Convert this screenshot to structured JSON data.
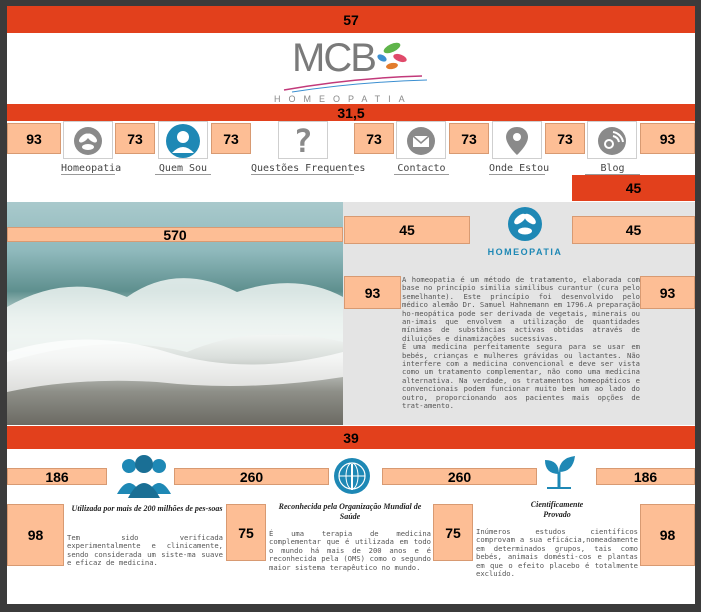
{
  "header": {
    "top_bar_label": "57",
    "brand_logo": "MCB",
    "brand_subtitle": "HOMEOPATIA",
    "sub_bar_label": "31,5"
  },
  "nav": {
    "spacers": {
      "outer": "93",
      "inner": "73"
    },
    "items": [
      {
        "label": "Homeopatia",
        "icon": "leaves-icon"
      },
      {
        "label": "Quem Sou",
        "icon": "user-icon"
      },
      {
        "label": "Questões Frequentes",
        "icon": "question-icon"
      },
      {
        "label": "Contacto",
        "icon": "mail-icon"
      },
      {
        "label": "Onde Estou",
        "icon": "location-pin-icon"
      },
      {
        "label": "Blog",
        "icon": "blog-icon"
      }
    ]
  },
  "intro": {
    "right_bar_label": "45",
    "image_width_label": "570",
    "spacer_45_left": "45",
    "spacer_45_right": "45",
    "spacer_93_left": "93",
    "spacer_93_right": "93",
    "logo_text": "HOMEOPATIA",
    "paragraph_1": "A homeopatia é um método de tratamento, elaborada com base no princípio similia similibus curantur (cura pelo semelhante). Este princípio foi desenvolvido pelo médico alemão Dr. Samuel Hahnemann em 1796.A preparação ho-meopática pode ser derivada de vegetais, minerais ou an-imais que envolvem a utilização de quantidades mínimas de substâncias activas obtidas através de diluições e dinamizações sucessivas.",
    "paragraph_2": "É uma medicina perfeitamente segura para se usar em bebés, crianças e mulheres grávidas ou lactantes. Não interfere com a medicina convencional e deve ser vista como um tratamento complementar, não como uma medicina alternativa. Na verdade, os tratamentos homeopáticos e convencionais podem funcionar muito bem um ao lado do outro, proporcionando aos pacientes mais opções de trat-amento."
  },
  "features": {
    "bar_label": "39",
    "spacers": {
      "s186": "186",
      "s260": "260",
      "s98": "98",
      "s75": "75"
    },
    "items": [
      {
        "title": "Utilizada por mais de 200 milhões de pes-soas",
        "text": "Tem sido verificada experimentalmente e clinicamente, sendo considerada um siste-ma suave e eficaz de medicina.",
        "icon": "people-icon"
      },
      {
        "title": "Reconhecida pela Organização Mundial de Saúde",
        "text": "É uma terapia de medicina complementar que é utilizada em todo o mundo há mais de 200 anos e é reconhecida pela (OMS) como o segundo maior sistema terapêutico no mundo.",
        "icon": "who-icon"
      },
      {
        "title": "Cientificamente Provado",
        "text": "Inúmeros estudos científicos comprovam a sua eficácia,nomeadamente em determinados grupos, tais como bebés, animais domésti-cos e plantas em que o efeito placebo é totalmente excluído.",
        "icon": "plant-icon"
      }
    ]
  },
  "colors": {
    "accent": "#e2401c",
    "peach": "#fdbe95",
    "teal": "#1e88b5"
  }
}
